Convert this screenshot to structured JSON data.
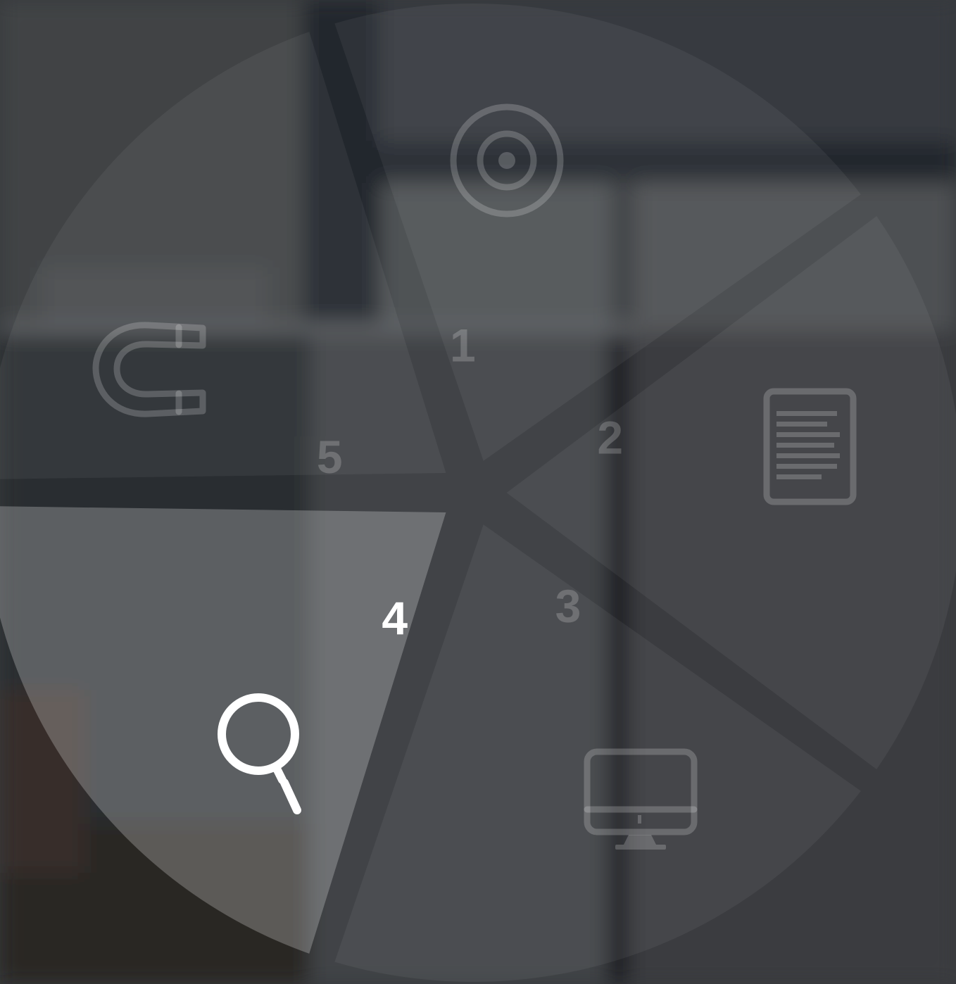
{
  "active_index": 3,
  "colors": {
    "segment": "rgba(255,255,255,0.055)",
    "segment_active": "rgba(255,255,255,0.24)",
    "label_inactive": "rgba(255,255,255,0.20)",
    "label_active": "#ffffff"
  },
  "segments": [
    {
      "number": "1",
      "icon": "target-icon"
    },
    {
      "number": "2",
      "icon": "document-icon"
    },
    {
      "number": "3",
      "icon": "monitor-icon"
    },
    {
      "number": "4",
      "icon": "search-icon"
    },
    {
      "number": "5",
      "icon": "magnet-icon"
    }
  ]
}
